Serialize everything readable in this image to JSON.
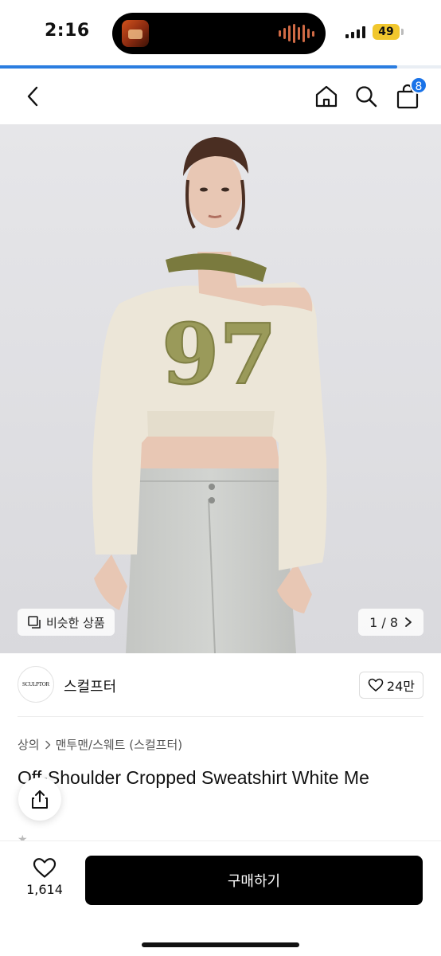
{
  "status_bar": {
    "time": "2:16",
    "battery": "49",
    "battery_color": "#f1c72e"
  },
  "page_load_progress": 0.9,
  "nav": {
    "back_icon": "chevron-left-icon",
    "home_icon": "home-icon",
    "search_icon": "search-icon",
    "cart_icon": "shopping-bag-icon",
    "cart_badge": "8",
    "badge_color": "#1a73e8"
  },
  "gallery": {
    "similar_label": "비슷한 상품",
    "page_indicator": "1 / 8",
    "background": "#e3e3e6"
  },
  "brand": {
    "logo_text": "SCULPTOR",
    "name": "스컬프터",
    "like_count": "24만"
  },
  "breadcrumb": {
    "level1": "상의",
    "level2": "맨투맨/스웨트 (스컬프터)"
  },
  "product": {
    "title": "Off-Shoulder Cropped Sweatshirt White Me"
  },
  "bottom_bar": {
    "wish_count": "1,614",
    "buy_label": "구매하기",
    "buy_color": "#000000"
  }
}
